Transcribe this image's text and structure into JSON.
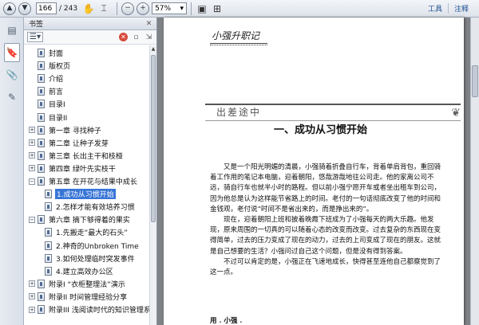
{
  "toolbar": {
    "page_current": "166",
    "page_total": "/ 243",
    "zoom": "57%",
    "tools_label": "工具",
    "comment_label": "注释"
  },
  "panel": {
    "title": "书签"
  },
  "bookmarks": [
    {
      "label": "封面",
      "toggle": "",
      "selected": false
    },
    {
      "label": "版权页",
      "toggle": "",
      "selected": false
    },
    {
      "label": "介绍",
      "toggle": "",
      "selected": false
    },
    {
      "label": "前言",
      "toggle": "",
      "selected": false
    },
    {
      "label": "目录I",
      "toggle": "",
      "selected": false
    },
    {
      "label": "目录II",
      "toggle": "",
      "selected": false
    },
    {
      "label": "第一章 寻找种子",
      "toggle": "+",
      "selected": false
    },
    {
      "label": "第二章 让种子发芽",
      "toggle": "+",
      "selected": false
    },
    {
      "label": "第三章 长出主干和枝桠",
      "toggle": "+",
      "selected": false
    },
    {
      "label": "第四章 绿叶先实枝干",
      "toggle": "+",
      "selected": false
    },
    {
      "label": "第五章 在开花与结果中成长",
      "toggle": "−",
      "selected": false
    },
    {
      "label": "1.成功从习惯开始",
      "toggle": "",
      "selected": true,
      "child": true
    },
    {
      "label": "2.怎样才能有效培养习惯",
      "toggle": "",
      "selected": false,
      "child": true
    },
    {
      "label": "第六章 摘下够得着的果实",
      "toggle": "−",
      "selected": false
    },
    {
      "label": "1.先搬走“最大的石头”",
      "toggle": "",
      "selected": false,
      "child": true
    },
    {
      "label": "2.神奇的Unbroken Time",
      "toggle": "",
      "selected": false,
      "child": true
    },
    {
      "label": "3.如何处理临时突发事件",
      "toggle": "",
      "selected": false,
      "child": true
    },
    {
      "label": "4.建立高效办公区",
      "toggle": "",
      "selected": false,
      "child": true
    },
    {
      "label": "附录I “衣柜整理法”演示",
      "toggle": "+",
      "selected": false
    },
    {
      "label": "附录II 时间管理经验分享",
      "toggle": "+",
      "selected": false
    },
    {
      "label": "附录III 浅阅读时代的知识管理系统",
      "toggle": "+",
      "selected": false
    }
  ],
  "document": {
    "logo": "小强升职记",
    "chapter_tag": "出差途中",
    "section_title": "一、成功从习惯开始",
    "paragraphs": [
      "又是一个阳光明媚的清晨，小强骑着折叠自行车，背着单肩背包，重回骑着工作用的笔记本电脑，迎着朝阳，悠哉游哉地往公司走。他的家离公司不远，骑自行车也就半小时的路程。但以前小强宁愿开车或者坐出租车到公司，因为他总是认为这样能节省路上的时间。老付的一句话彻底改变了他的时间和金钱观，老付说“时间不是省出来的，而是挣出来的”。",
      "现在，迎着朝阳上班和披着晚霞下班成为了小强每天的两大乐趣。他发现，原来周围的一切真的可以随着心态的改变而改变。过去复杂的东西现在变得简单，过去的压力变成了现在的动力，过去的上司变成了现在的朋友。这就是自己想要的生活？小强问过自己这个问题，但是没有得到答案。",
      "不过可以肯定的是，小强正在飞速地成长，快得甚至连他自己都察觉到了这一点。"
    ],
    "subhead": "用 . 小强 ."
  }
}
